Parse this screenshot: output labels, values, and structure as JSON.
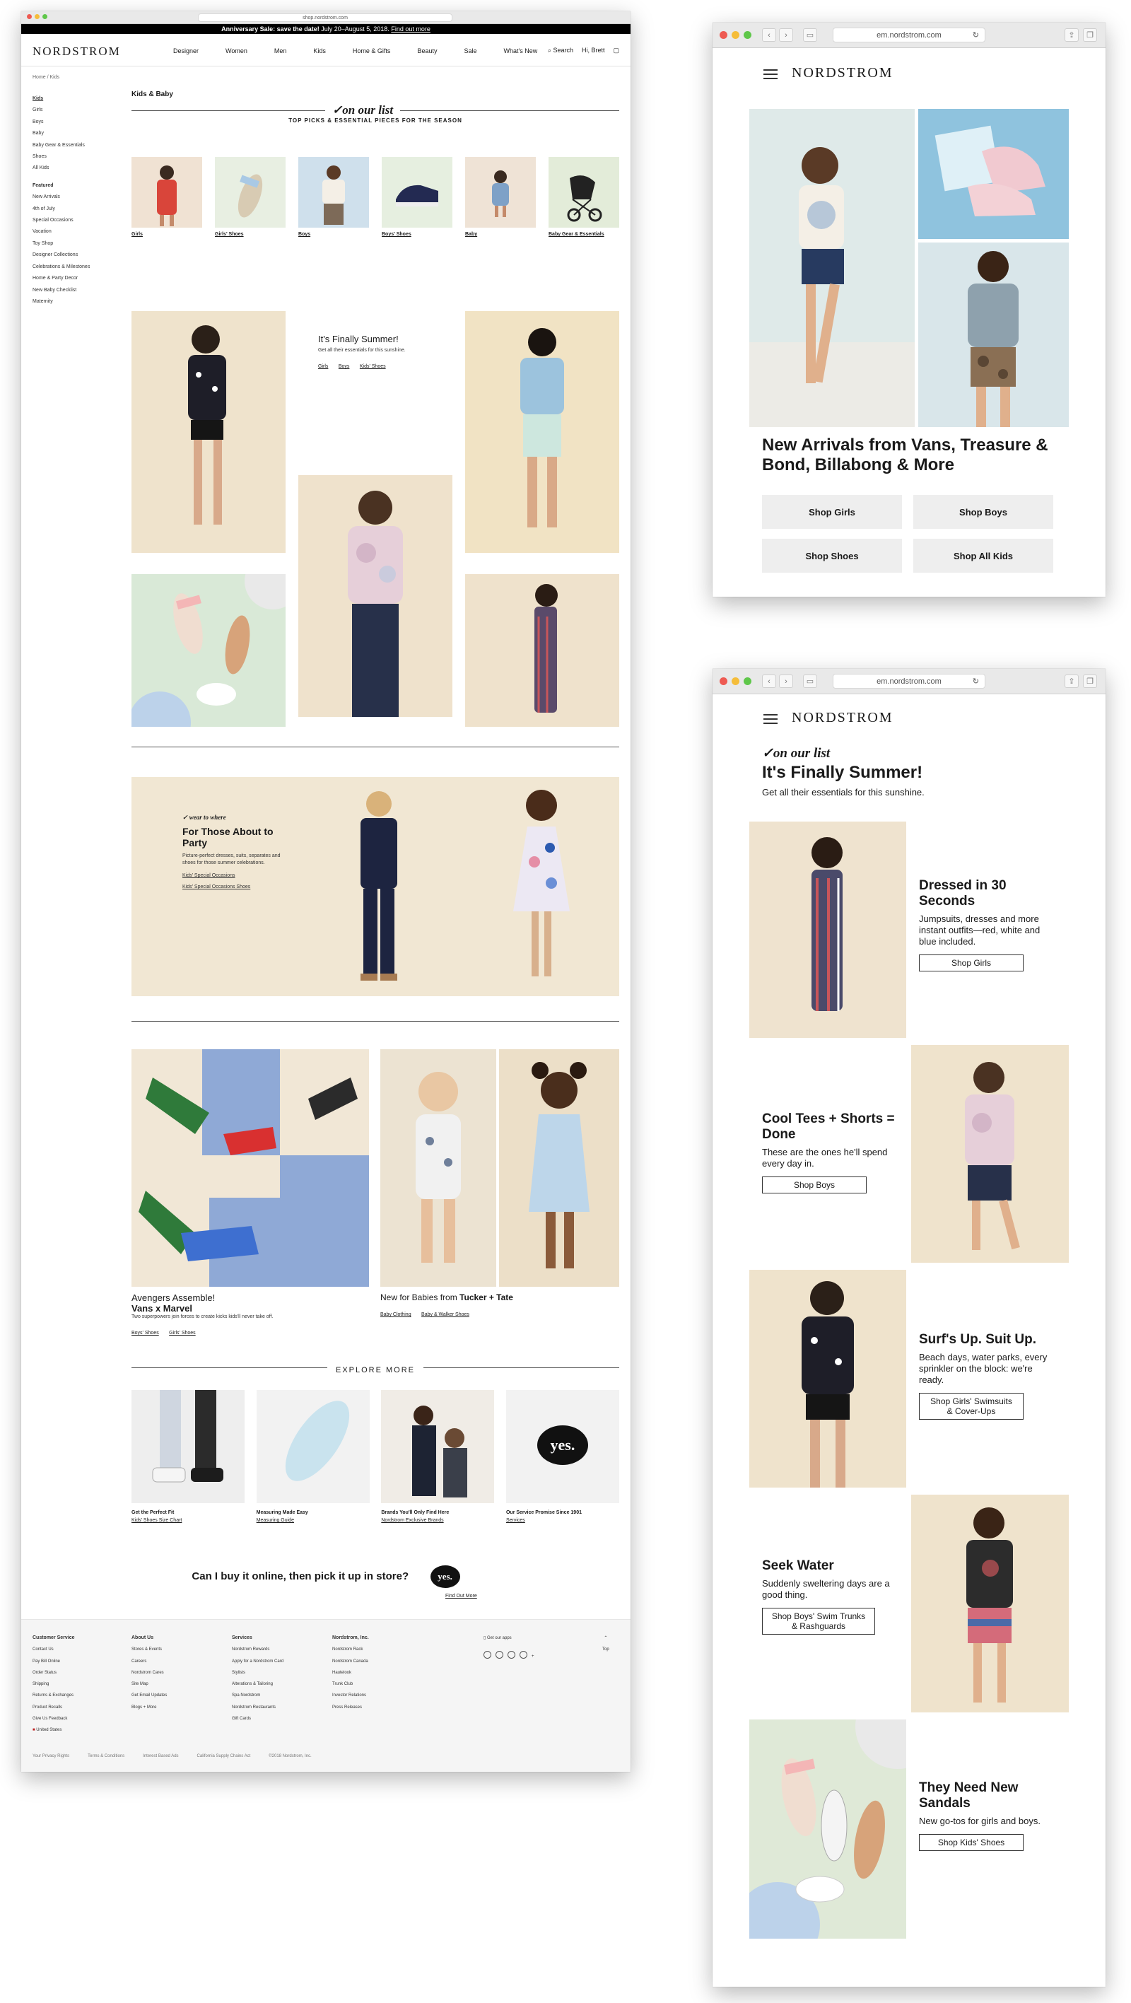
{
  "desktop": {
    "browser_url": "shop.nordstrom.com",
    "promo_bold": "Anniversary Sale: save the date!",
    "promo_text": "July 20–August 5, 2018.",
    "promo_link": "Find out more",
    "logo": "NORDSTROM",
    "nav": [
      "Designer",
      "Women",
      "Men",
      "Kids",
      "Home & Gifts",
      "Beauty",
      "Sale",
      "What's New"
    ],
    "search_label": "Search",
    "account_label": "Hi, Brett",
    "breadcrumb": "Home / Kids",
    "sidebar_items": [
      "Kids",
      "Girls",
      "Boys",
      "Baby",
      "Baby Gear & Essentials",
      "Shoes",
      "All Kids"
    ],
    "sidebar_featured_heading": "Featured",
    "sidebar_featured": [
      "New Arrivals",
      "4th of July",
      "Special Occasions",
      "Vacation",
      "Toy Shop",
      "Designer Collections",
      "Celebrations & Milestones",
      "Home & Party Decor",
      "New Baby Checklist",
      "Maternity"
    ],
    "section_title": "Kids & Baby",
    "on_our_list": "✓on our list",
    "tagline": "TOP PICKS & ESSENTIAL PIECES FOR THE SEASON",
    "categories": [
      "Girls",
      "Girls' Shoes",
      "Boys",
      "Boys' Shoes",
      "Baby",
      "Baby Gear & Essentials"
    ],
    "summer_title": "It's Finally Summer!",
    "summer_sub": "Get all their essentials for this sunshine.",
    "summer_links": [
      "Girls",
      "Boys",
      "Kids' Shoes"
    ],
    "party_kicker": "✓ wear to where",
    "party_title": "For Those About to Party",
    "party_body": "Picture-perfect dresses, suits, separates and shoes for those summer celebrations.",
    "party_links": [
      "Kids' Special Occasions",
      "Kids' Special Occasions Shoes"
    ],
    "avengers_title": "Avengers Assemble!",
    "avengers_bold": "Vans x Marvel",
    "avengers_body": "Two superpowers join forces to create kicks kids'll never take off.",
    "avengers_links": [
      "Boys' Shoes",
      "Girls' Shoes"
    ],
    "babies_title": "New for Babies from",
    "babies_bold": "Tucker + Tate",
    "babies_links": [
      "Baby Clothing",
      "Baby & Walker Shoes"
    ],
    "explore_heading": "EXPLORE MORE",
    "explore": [
      {
        "title": "Get the Perfect Fit",
        "link": "Kids' Shoes Size Chart"
      },
      {
        "title": "Measuring Made Easy",
        "link": "Measuring Guide"
      },
      {
        "title": "Brands You'll Only Find Here",
        "link": "Nordstrom Exclusive Brands"
      },
      {
        "title": "Our Service Promise Since 1901",
        "link": "Services"
      }
    ],
    "yes_badge": "yes.",
    "bopis_question": "Can I buy it online, then pick it up in store?",
    "bopis_link": "Find Out More",
    "footer": {
      "cols": [
        {
          "heading": "Customer Service",
          "items": [
            "Contact Us",
            "Pay Bill Online",
            "Order Status",
            "Shipping",
            "Returns & Exchanges",
            "Product Recalls",
            "Give Us Feedback",
            "United States"
          ]
        },
        {
          "heading": "About Us",
          "items": [
            "Stores & Events",
            "Careers",
            "Nordstrom Cares",
            "Site Map",
            "Get Email Updates",
            "Blogs + More"
          ]
        },
        {
          "heading": "Services",
          "items": [
            "Nordstrom Rewards",
            "Apply for a Nordstrom Card",
            "Stylists",
            "Alterations & Tailoring",
            "Spa Nordstrom",
            "Nordstrom Restaurants",
            "Gift Cards"
          ]
        },
        {
          "heading": "Nordstrom, Inc.",
          "items": [
            "Nordstrom Rack",
            "Nordstrom Canada",
            "Hautelook",
            "Trunk Club",
            "Investor Relations",
            "Press Releases"
          ]
        }
      ],
      "app_label": "Get our apps",
      "top_label": "Top",
      "legal": [
        "Your Privacy Rights",
        "Terms & Conditions",
        "Interest Based Ads",
        "California Supply Chains Act",
        "©2018 Nordstrom, Inc."
      ]
    }
  },
  "mobile1": {
    "browser_url": "em.nordstrom.com",
    "logo": "NORDSTROM",
    "headline": "New Arrivals from Vans, Treasure & Bond, Billabong & More",
    "buttons": [
      "Shop Girls",
      "Shop Boys",
      "Shop Shoes",
      "Shop All Kids"
    ]
  },
  "mobile2": {
    "browser_url": "em.nordstrom.com",
    "logo": "NORDSTROM",
    "on_our_list": "✓on our list",
    "title": "It's Finally Summer!",
    "sub": "Get all their essentials for this sunshine.",
    "rows": [
      {
        "heading": "Dressed in 30 Seconds",
        "body": "Jumpsuits, dresses and more instant outfits—red, white and blue included.",
        "button": "Shop Girls"
      },
      {
        "heading": "Cool Tees + Shorts = Done",
        "body": "These are the ones he'll spend every day in.",
        "button": "Shop Boys"
      },
      {
        "heading": "Surf's Up. Suit Up.",
        "body": "Beach days, water parks, every sprinkler on the block: we're ready.",
        "button": "Shop Girls' Swimsuits & Cover-Ups"
      },
      {
        "heading": "Seek Water",
        "body": "Suddenly sweltering days are a good thing.",
        "button": "Shop Boys' Swim Trunks & Rashguards"
      },
      {
        "heading": "They Need New Sandals",
        "body": "New go-tos for girls and boys.",
        "button": "Shop Kids' Shoes"
      }
    ]
  }
}
